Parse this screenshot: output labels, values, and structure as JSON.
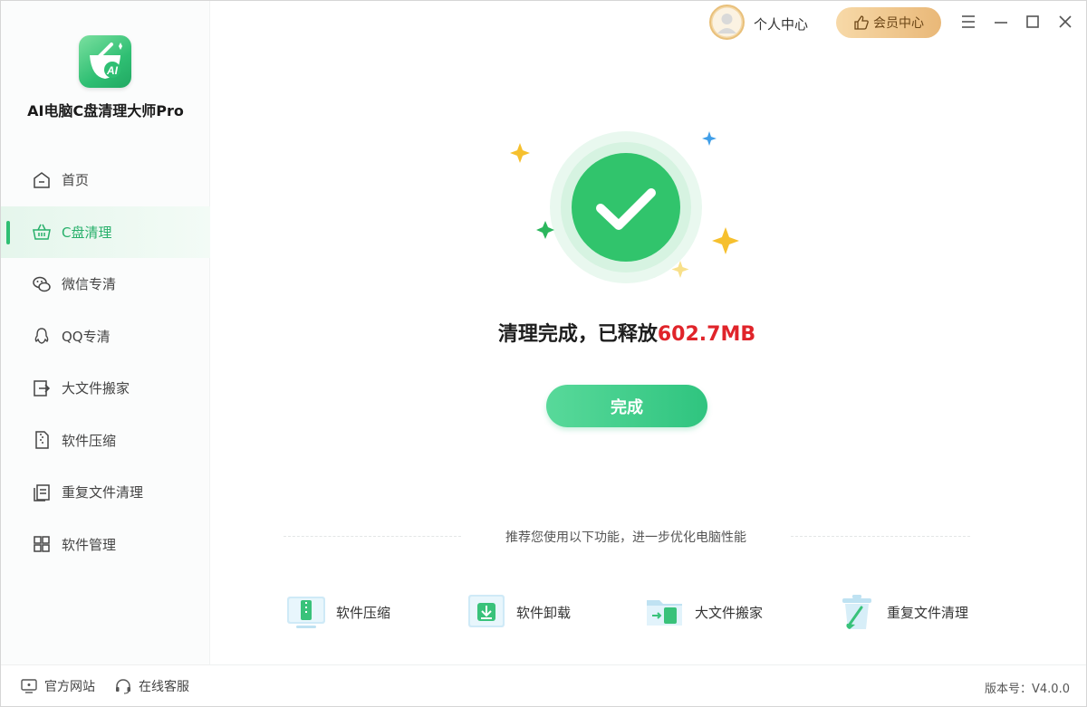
{
  "app": {
    "name": "AI电脑C盘清理大师Pro"
  },
  "header": {
    "user_label": "个人中心",
    "vip_label": "会员中心"
  },
  "sidebar": {
    "items": [
      {
        "label": "首页",
        "icon": "home-icon"
      },
      {
        "label": "C盘清理",
        "icon": "basket-icon",
        "active": true
      },
      {
        "label": "微信专清",
        "icon": "wechat-icon"
      },
      {
        "label": "QQ专清",
        "icon": "qq-icon"
      },
      {
        "label": "大文件搬家",
        "icon": "file-move-icon"
      },
      {
        "label": "软件压缩",
        "icon": "zip-icon"
      },
      {
        "label": "重复文件清理",
        "icon": "duplicate-file-icon"
      },
      {
        "label": "软件管理",
        "icon": "apps-grid-icon"
      }
    ]
  },
  "main": {
    "result_prefix": "清理完成，已释放",
    "result_amount": "602.7MB",
    "done_label": "完成",
    "recommend_text": "推荐您使用以下功能，进一步优化电脑性能",
    "recommend": [
      {
        "label": "软件压缩",
        "icon": "compress-icon"
      },
      {
        "label": "软件卸载",
        "icon": "uninstall-icon"
      },
      {
        "label": "大文件搬家",
        "icon": "folder-move-icon"
      },
      {
        "label": "重复文件清理",
        "icon": "trash-clean-icon"
      }
    ]
  },
  "footer": {
    "website": "官方网站",
    "support": "在线客服",
    "version": "版本号：V4.0.0"
  },
  "colors": {
    "accent": "#2fbf73",
    "amount": "#e0242a",
    "vip": "#e9b878"
  }
}
